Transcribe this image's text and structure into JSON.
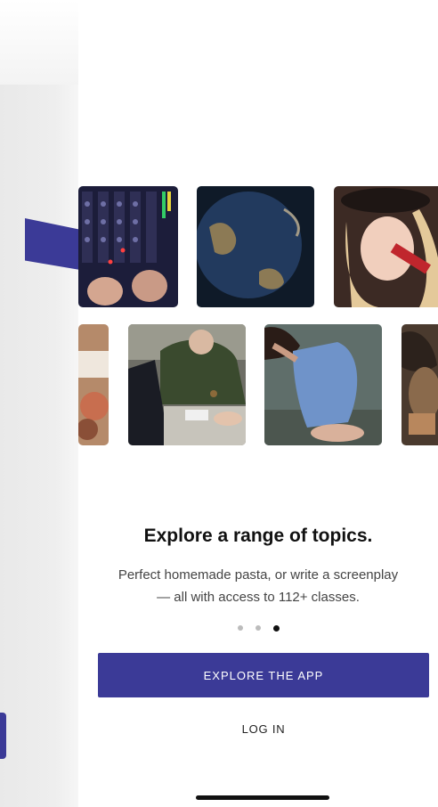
{
  "onboarding": {
    "headline": "Explore a range of topics.",
    "subtitle_line1": "Perfect homemade pasta, or write a screenplay",
    "subtitle_line2": "— all with access to 112+ classes.",
    "pagination": {
      "total": 3,
      "active_index": 2
    },
    "primary_button_label": "EXPLORE THE APP",
    "secondary_button_label": "LOG IN"
  },
  "colors": {
    "accent": "#3b3a97",
    "side_panel": "#ececec"
  },
  "gallery": {
    "row1": [
      "music-mixing-console-photo",
      "globe-photo",
      "singer-microphone-photo"
    ],
    "row2": [
      "cooking-photo",
      "chess-players-photo",
      "dancer-photo",
      "partial-photo"
    ]
  }
}
